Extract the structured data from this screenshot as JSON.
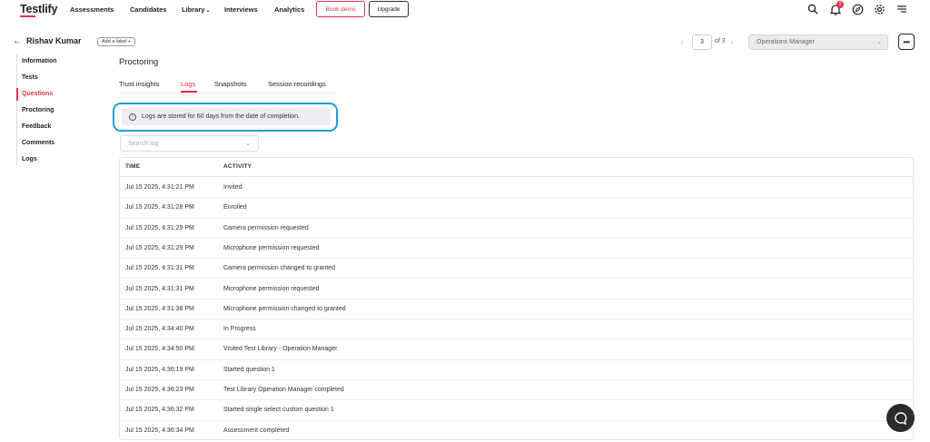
{
  "app": {
    "logo": "Testlify",
    "accent_color": "#e5304a",
    "highlight_color": "#1aa0d8"
  },
  "topnav": {
    "items": [
      "Assessments",
      "Candidates",
      "Library",
      "Interviews",
      "Analytics"
    ],
    "library_caret": "⌄",
    "book_demo_label": "Book demo",
    "upgrade_label": "Upgrade",
    "notification_count": "2",
    "icons": [
      "search-icon",
      "bell-icon",
      "compass-icon",
      "gear-icon",
      "menu-icon"
    ]
  },
  "header": {
    "back_arrow": "←",
    "candidate_name": "Rishav Kumar",
    "add_label": "Add a label +",
    "pager": {
      "prev": "‹",
      "current": "3",
      "of_total": "of 3",
      "next": "›"
    },
    "role_select": "Operations Manager",
    "more": "•••"
  },
  "sidenav": {
    "items": [
      "Information",
      "Tests",
      "Questions",
      "Proctoring",
      "Feedback",
      "Comments",
      "Logs"
    ],
    "active": "Questions"
  },
  "main": {
    "section_title": "Proctoring",
    "tabs": [
      "Trust insights",
      "Logs",
      "Snapshots",
      "Session recordings"
    ],
    "active_tab": "Logs",
    "info_message": "Logs are stored for 60 days from the date of completion.",
    "search_placeholder": "Search log",
    "table": {
      "headers": [
        "TIME",
        "ACTIVITY"
      ],
      "rows": [
        {
          "time": "Jul 15 2025, 4:31:21 PM",
          "activity": "Invited"
        },
        {
          "time": "Jul 15 2025, 4:31:28 PM",
          "activity": "Enrolled"
        },
        {
          "time": "Jul 15 2025, 4:31:29 PM",
          "activity": "Camera permission requested"
        },
        {
          "time": "Jul 15 2025, 4:31:29 PM",
          "activity": "Microphone permission requested"
        },
        {
          "time": "Jul 15 2025, 4:31:31 PM",
          "activity": "Camera permission changed to granted"
        },
        {
          "time": "Jul 15 2025, 4:31:31 PM",
          "activity": "Microphone permission requested"
        },
        {
          "time": "Jul 15 2025, 4:31:38 PM",
          "activity": "Microphone permission changed to granted"
        },
        {
          "time": "Jul 15 2025, 4:34:40 PM",
          "activity": "In Progress"
        },
        {
          "time": "Jul 15 2025, 4:34:50 PM",
          "activity": "Visited Test Library - Operation Manager"
        },
        {
          "time": "Jul 15 2025, 4:36:19 PM",
          "activity": "Started question 1"
        },
        {
          "time": "Jul 15 2025, 4:36:23 PM",
          "activity": "Test Library Operation Manager completed"
        },
        {
          "time": "Jul 15 2025, 4:36:32 PM",
          "activity": "Started single select custom question 1"
        },
        {
          "time": "Jul 15 2025, 4:36:34 PM",
          "activity": "Assessment completed"
        }
      ]
    }
  }
}
